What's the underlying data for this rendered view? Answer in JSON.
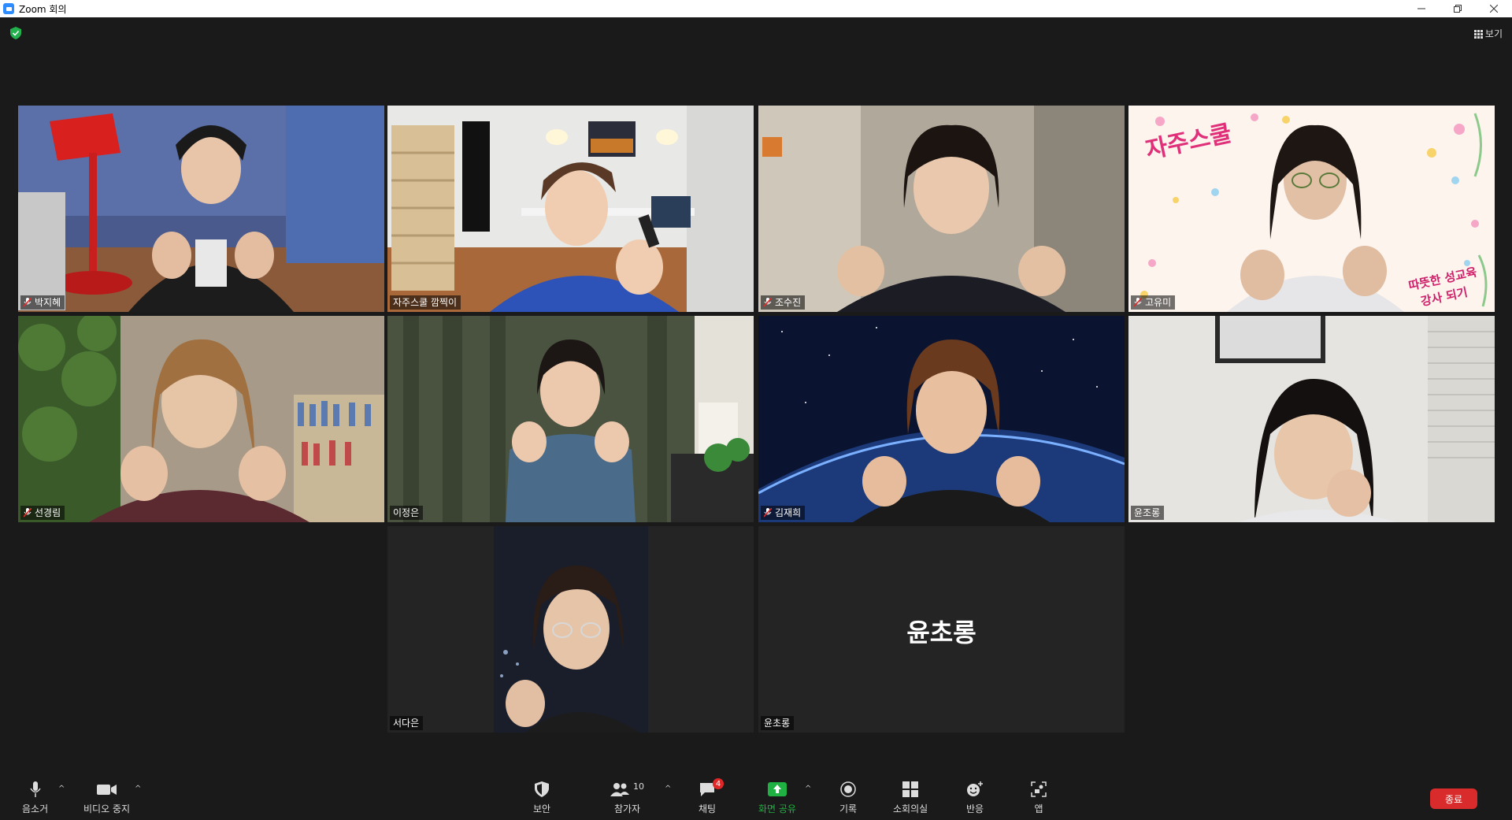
{
  "window": {
    "title": "Zoom 회의"
  },
  "header": {
    "view_label": "보기"
  },
  "tiles": [
    {
      "name": "박지혜",
      "muted": true
    },
    {
      "name": "자주스쿨 깜찍이",
      "muted": false,
      "active": true
    },
    {
      "name": "조수진",
      "muted": true
    },
    {
      "name": "고유미",
      "muted": true,
      "bg_title": "자주스쿨",
      "bg_line1": "따뜻한 성교육",
      "bg_line2": "강사 되기"
    },
    {
      "name": "선경림",
      "muted": true
    },
    {
      "name": "이정은",
      "muted": false
    },
    {
      "name": "김재희",
      "muted": true
    },
    {
      "name": "윤조롱",
      "muted": false
    },
    {
      "name": "서다은",
      "muted": false
    },
    {
      "name": "윤초롱",
      "muted": false,
      "video_off": true,
      "big_name": "윤초롱"
    }
  ],
  "toolbar": {
    "mute_label": "음소거",
    "video_label": "비디오 중지",
    "security_label": "보안",
    "participants_label": "참가자",
    "participants_count": "10",
    "chat_label": "채팅",
    "chat_badge": "4",
    "share_label": "화면 공유",
    "record_label": "기록",
    "breakout_label": "소회의실",
    "reactions_label": "반응",
    "apps_label": "앱",
    "end_label": "종료"
  },
  "colors": {
    "active_border": "#c6e44a",
    "share_green": "#1fb141",
    "end_red": "#d92b2b",
    "muted_red": "#e02828"
  }
}
